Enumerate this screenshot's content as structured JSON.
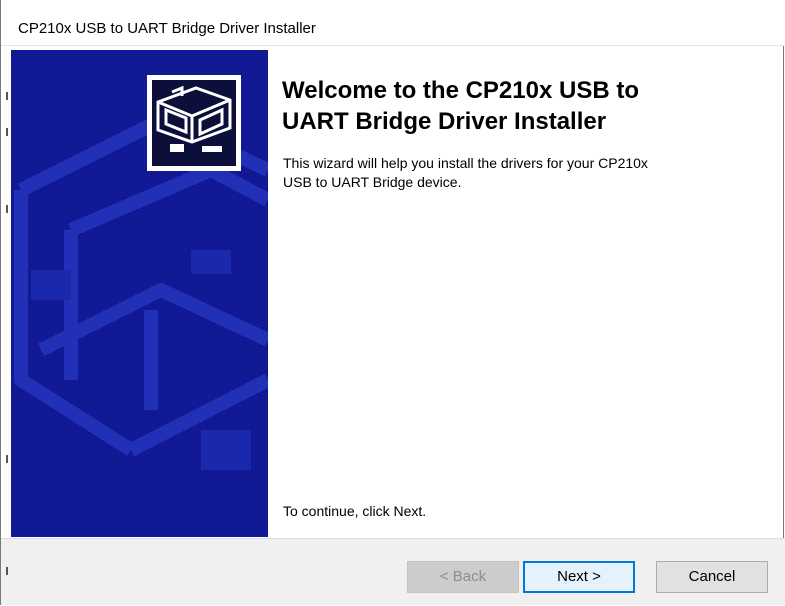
{
  "window": {
    "title": "CP210x USB to UART Bridge Driver Installer"
  },
  "welcome": {
    "heading_line1": "Welcome to the CP210x USB to",
    "heading_line2": "UART Bridge Driver Installer",
    "description_line1": "This wizard will help you install the drivers for your CP210x",
    "description_line2": "USB to UART Bridge device.",
    "continue_text": "To continue, click Next."
  },
  "buttons": {
    "back": "< Back",
    "next": "Next >",
    "cancel": "Cancel"
  },
  "colors": {
    "panel_blue": "#0d1590",
    "focus_border": "#0078d7"
  },
  "icons": {
    "installer_logo": "installer-drive-icon"
  }
}
